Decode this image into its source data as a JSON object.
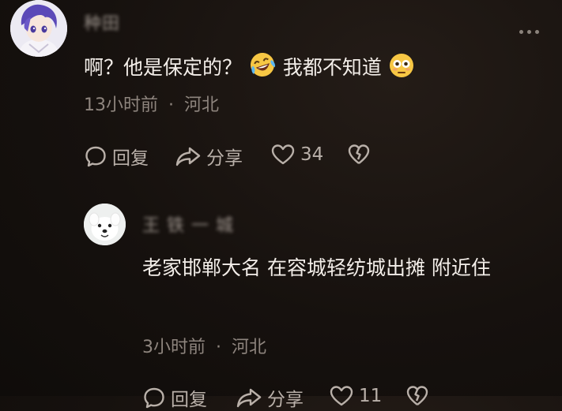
{
  "comment": {
    "username": "种田",
    "text_part1": "啊？他是保定的？",
    "emoji1": "laughing-crying-emoji",
    "text_part2": "我都不知道",
    "emoji2": "flushed-emoji",
    "time": "13小时前",
    "separator": "·",
    "location": "河北",
    "actions": {
      "reply_label": "回复",
      "share_label": "分享",
      "like_count": "34"
    }
  },
  "reply": {
    "username": "王 铁 一 城",
    "text": "老家邯郸大名 在容城轻纺城出摊 附近住",
    "time": "3小时前",
    "separator": "·",
    "location": "河北",
    "actions": {
      "reply_label": "回复",
      "share_label": "分享",
      "like_count": "11"
    }
  },
  "colors": {
    "background": "#16110e",
    "text": "#f3eee9",
    "meta": "#8e857e",
    "action": "#b9b0a9"
  }
}
